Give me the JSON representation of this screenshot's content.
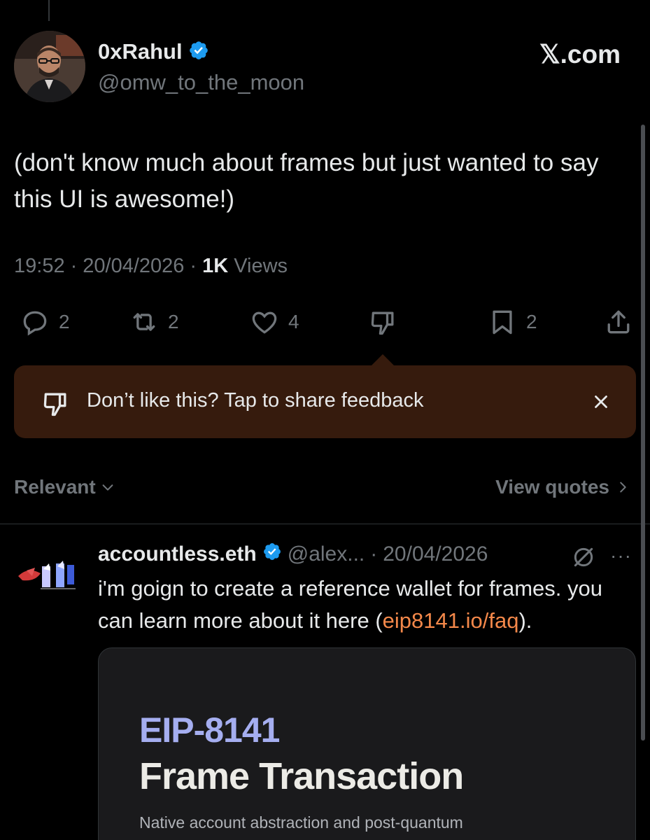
{
  "tweet": {
    "author_name": "0xRahul",
    "author_handle": "@omw_to_the_moon",
    "brand": "𝕏.com",
    "text": "(don't know much about frames but just wanted to say this UI is awesome!)",
    "time": "19:52",
    "date": "20/04/2026",
    "views_count": "1K",
    "views_label": "Views",
    "separator": "·"
  },
  "actions": {
    "replies": "2",
    "reposts": "2",
    "likes": "4",
    "bookmarks": "2"
  },
  "feedback": {
    "text": "Don’t like this? Tap to share feedback"
  },
  "replies_header": {
    "sort_label": "Relevant",
    "quotes_label": "View quotes"
  },
  "reply": {
    "name": "accountless.eth",
    "handle": "@alex...",
    "separator": "·",
    "date": "20/04/2026",
    "more": "···",
    "text_before": "i'm goign to create a reference wallet for frames. you can learn more about it here (",
    "link": "eip8141.io/faq",
    "text_after": ").",
    "card": {
      "eip": "EIP-8141",
      "title": "Frame Transaction",
      "subtitle": "Native account abstraction and post-quantum"
    }
  },
  "colors": {
    "background": "#000000",
    "verified": "#1d9bf0",
    "feedback_bg": "#361b0d",
    "link": "#f4884a",
    "muted": "#71767b"
  },
  "icons": [
    "reply-icon",
    "repost-icon",
    "like-icon",
    "dislike-icon",
    "bookmark-icon",
    "share-icon",
    "close-icon",
    "verified-icon",
    "chevron-down-icon",
    "chevron-right-icon",
    "grok-icon"
  ]
}
